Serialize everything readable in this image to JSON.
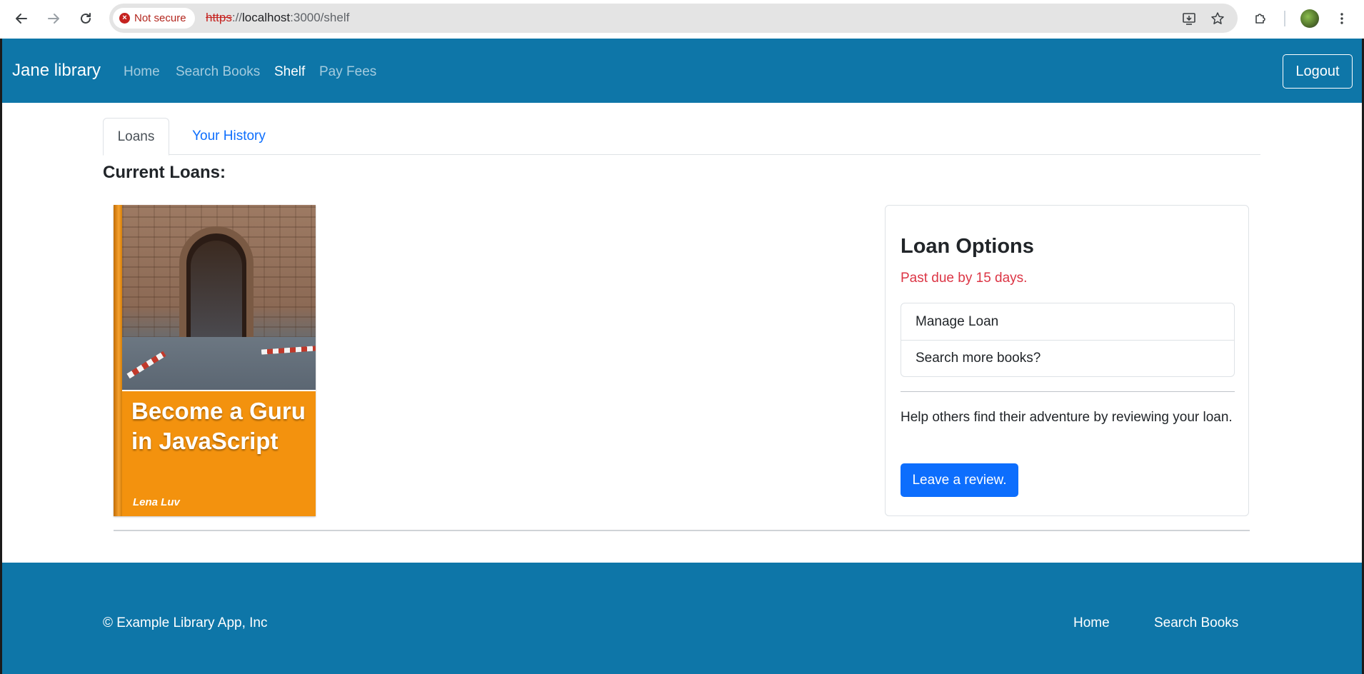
{
  "browser": {
    "security_label": "Not secure",
    "url_protocol": "https",
    "url_separator": "://",
    "url_host": "localhost",
    "url_rest": ":3000/shelf",
    "icons": [
      "back-icon",
      "forward-icon",
      "reload-icon",
      "install-icon",
      "star-icon",
      "extensions-icon",
      "profile-avatar",
      "menu-icon"
    ]
  },
  "navbar": {
    "brand": "Jane library",
    "links": [
      {
        "label": "Home",
        "active": false
      },
      {
        "label": "Search Books",
        "active": false
      },
      {
        "label": "Shelf",
        "active": true
      },
      {
        "label": "Pay Fees",
        "active": false
      }
    ],
    "logout_label": "Logout",
    "color": "#0e76a8"
  },
  "tabs": [
    {
      "label": "Loans",
      "active": true
    },
    {
      "label": "Your History",
      "active": false
    }
  ],
  "main": {
    "section_title": "Current Loans:"
  },
  "book": {
    "title": "Become a Guru in JavaScript",
    "author": "Lena Luv",
    "cover_color": "#f3920e"
  },
  "loan_options": {
    "title": "Loan Options",
    "status": "Past due by 15 days.",
    "status_color": "#dc3545",
    "actions": [
      {
        "label": "Manage Loan"
      },
      {
        "label": "Search more books?"
      }
    ],
    "help_text": "Help others find their adventure by reviewing your loan.",
    "review_button": "Leave a review.",
    "button_color": "#0d6efd"
  },
  "footer": {
    "copyright": "© Example Library App, Inc",
    "links": [
      {
        "label": "Home"
      },
      {
        "label": "Search Books"
      }
    ]
  }
}
